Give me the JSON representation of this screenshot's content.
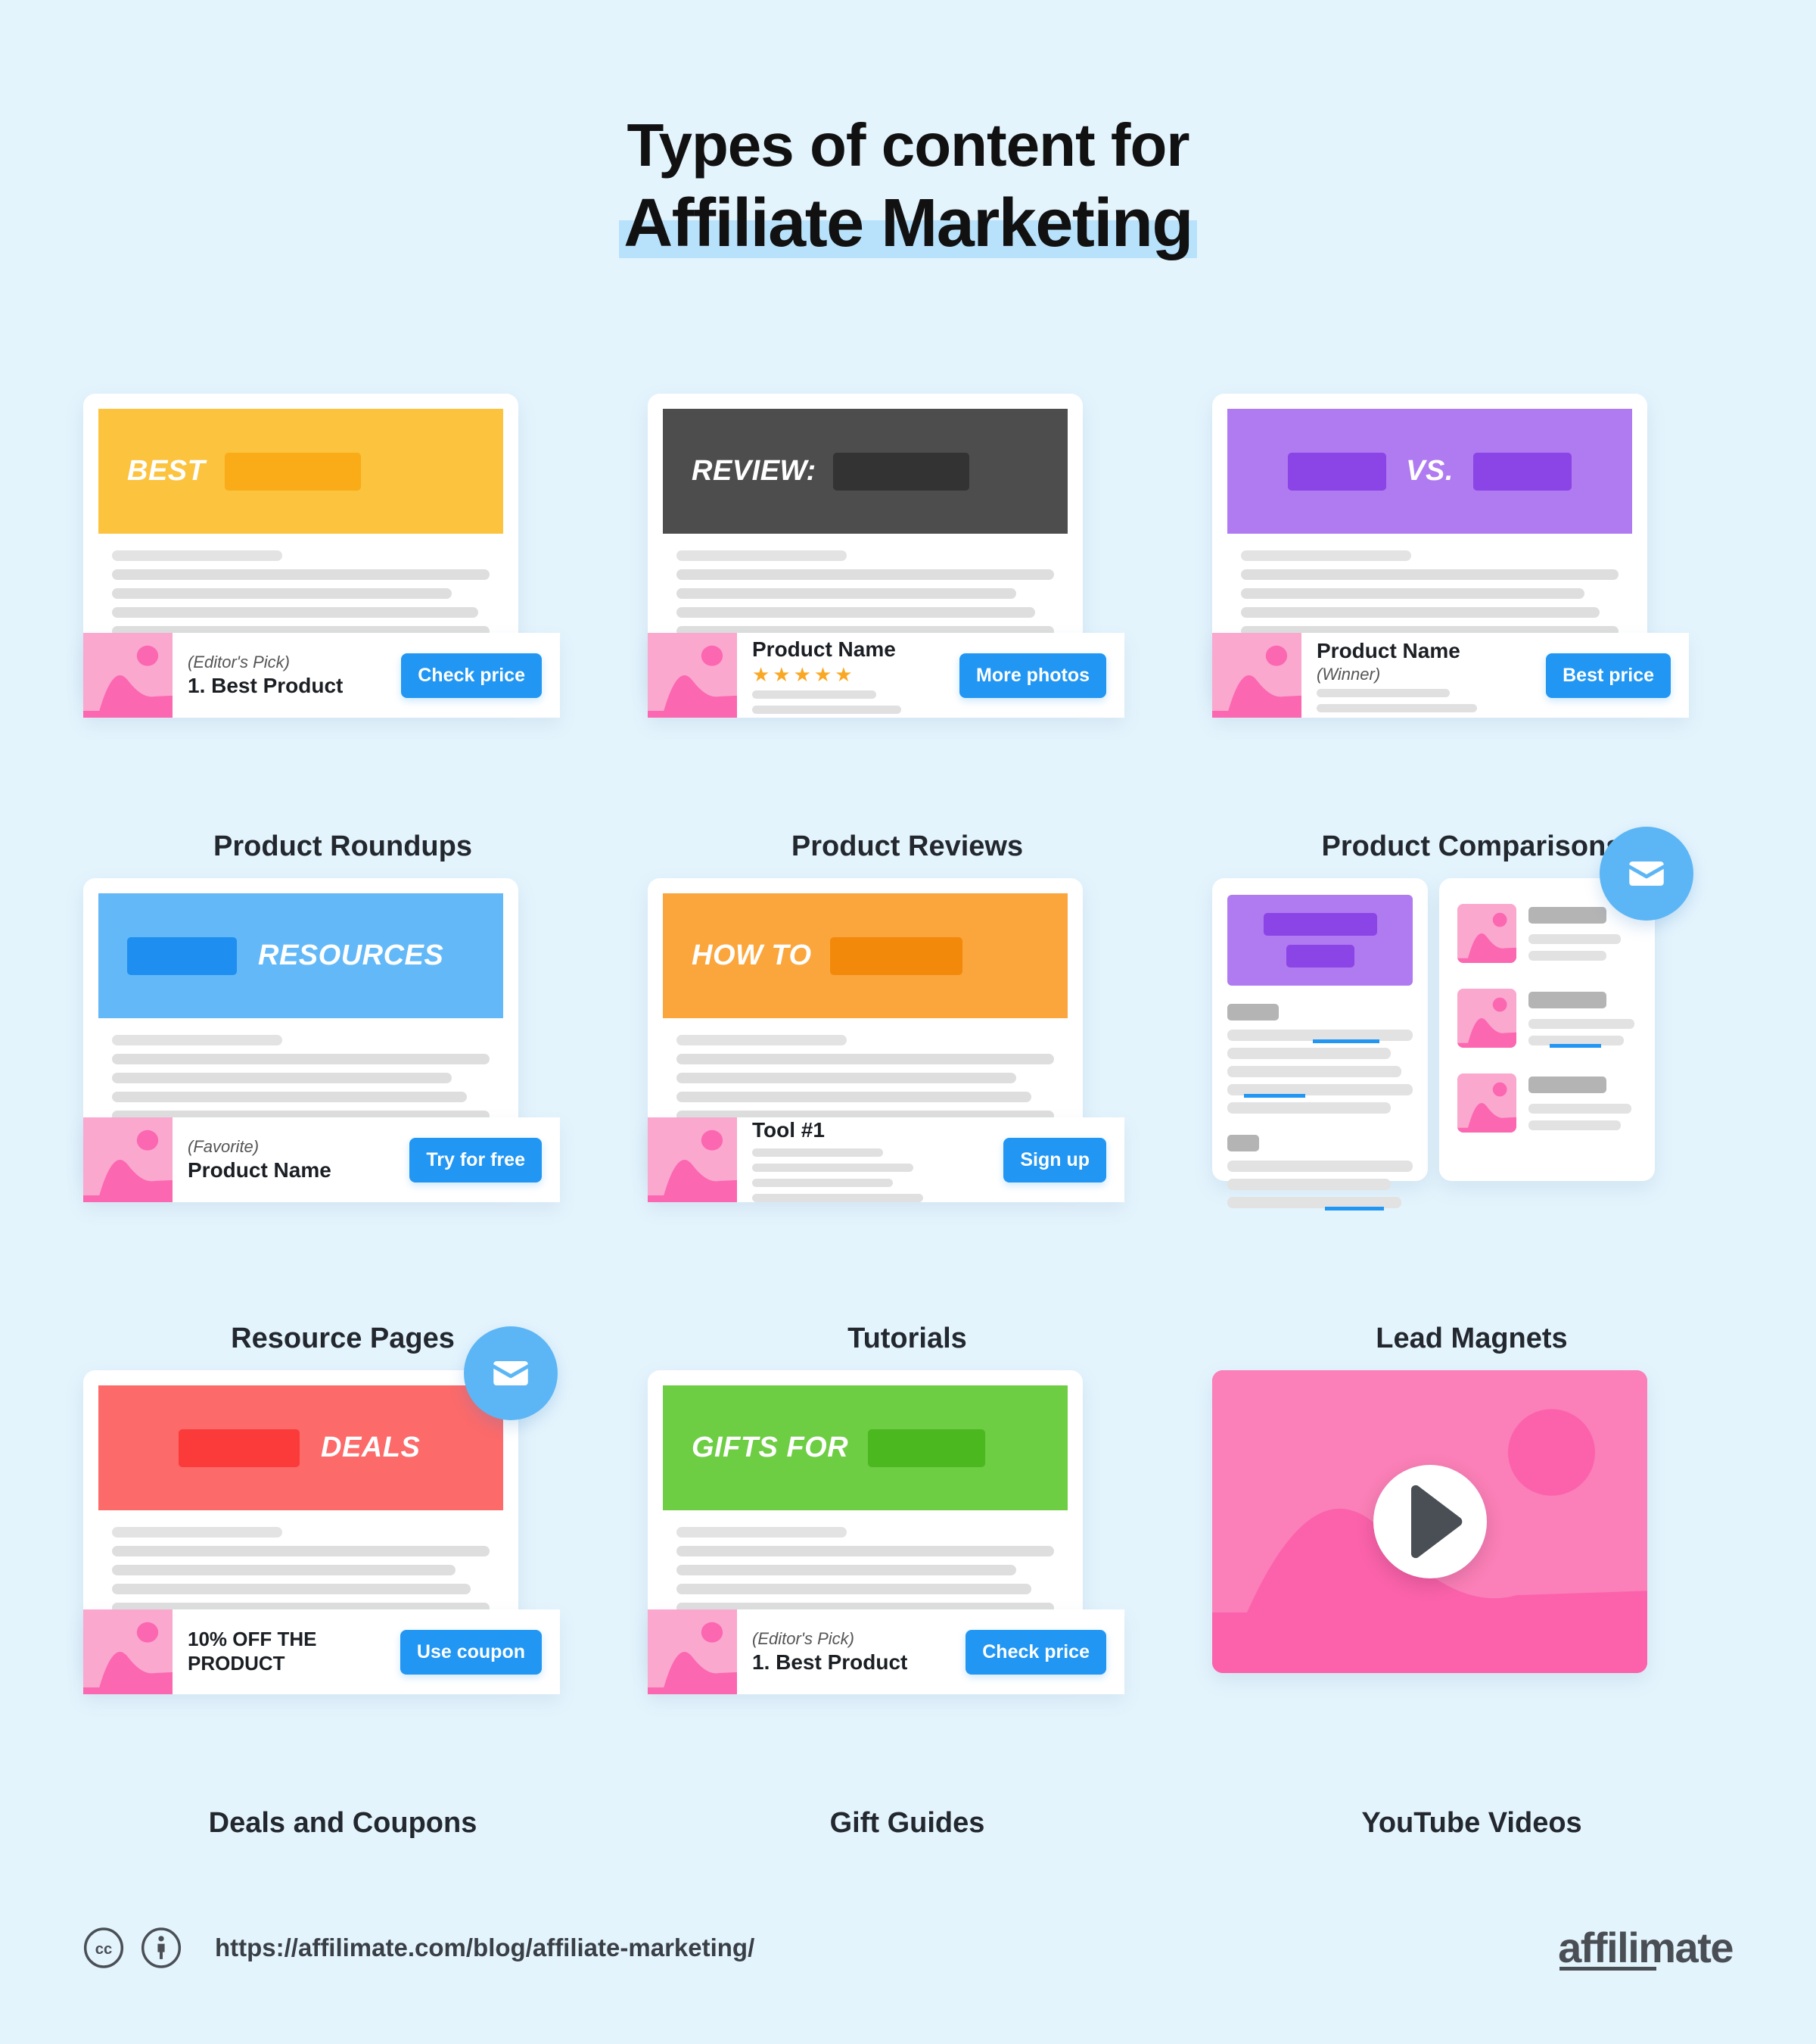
{
  "header": {
    "line1": "Types of content for",
    "line2": "Affiliate Marketing",
    "highlight_color": "#b8e2fb"
  },
  "colors": {
    "background": "#e4f4fd",
    "cta_blue": "#2196f3",
    "badge_blue": "#5cb6f5",
    "thumb_pink": "#fba8cf",
    "star_orange": "#f9a825"
  },
  "cards": [
    {
      "label": "Product Roundups",
      "banner": {
        "text": "BEST",
        "text_side": "left",
        "bg": "#fcc33f",
        "block_color": "#f9ac17",
        "block_width": 180
      },
      "product": {
        "sub": "(Editor's Pick)",
        "name": "1. Best Product",
        "sub_first": true
      },
      "cta": "Check price"
    },
    {
      "label": "Product Reviews",
      "banner": {
        "text": "REVIEW:",
        "text_side": "left",
        "bg": "#4d4d4d",
        "block_color": "#333333",
        "block_width": 180
      },
      "product": {
        "name": "Product Name",
        "stars": 5,
        "star_glyph": "★",
        "lines_below": 2
      },
      "cta": "More photos"
    },
    {
      "label": "Product Comparisons",
      "banner": {
        "text": "VS.",
        "text_side": "center",
        "bg": "#b07af0",
        "block_color": "#8b44e5",
        "block_width": 130
      },
      "product": {
        "name": "Product Name",
        "sub": "(Winner)",
        "sub_first": false,
        "lines_below": 2
      },
      "cta": "Best price"
    },
    {
      "label": "Resource Pages",
      "banner": {
        "text": "RESOURCES",
        "text_side": "right",
        "bg": "#63b9f8",
        "block_color": "#1f8ef1",
        "block_width": 145
      },
      "product": {
        "sub": "(Favorite)",
        "name": "Product Name",
        "sub_first": true
      },
      "cta": "Try for free"
    },
    {
      "label": "Tutorials",
      "banner": {
        "text": "HOW TO",
        "text_side": "left",
        "bg": "#fba63c",
        "block_color": "#f2890b",
        "block_width": 175
      },
      "product": {
        "name": "Tool #1",
        "lines_below": 4
      },
      "cta": "Sign up"
    },
    {
      "label": "Lead Magnets",
      "mail_icon": "envelope-icon"
    },
    {
      "label": "Deals and Coupons",
      "banner": {
        "text": "DEALS",
        "text_side": "right",
        "bg": "#fc6a6a",
        "block_color": "#fb3a3a",
        "block_width": 160
      },
      "product": {
        "name": "10% OFF THE PRODUCT",
        "caps": true
      },
      "cta": "Use coupon",
      "mail_icon": "envelope-icon"
    },
    {
      "label": "Gift Guides",
      "banner": {
        "text": "GIFTS FOR",
        "text_side": "left",
        "bg": "#6dcd43",
        "block_color": "#4cb81f",
        "block_width": 155
      },
      "product": {
        "sub": "(Editor's Pick)",
        "name": "1. Best Product",
        "sub_first": true
      },
      "cta": "Check price"
    },
    {
      "label": "YouTube Videos",
      "play_icon": "play-icon"
    }
  ],
  "footer": {
    "cc_icon": "creative-commons-icon",
    "by_icon": "attribution-icon",
    "url": "https://affilimate.com/blog/affiliate-marketing/",
    "brand": "affilimate"
  }
}
